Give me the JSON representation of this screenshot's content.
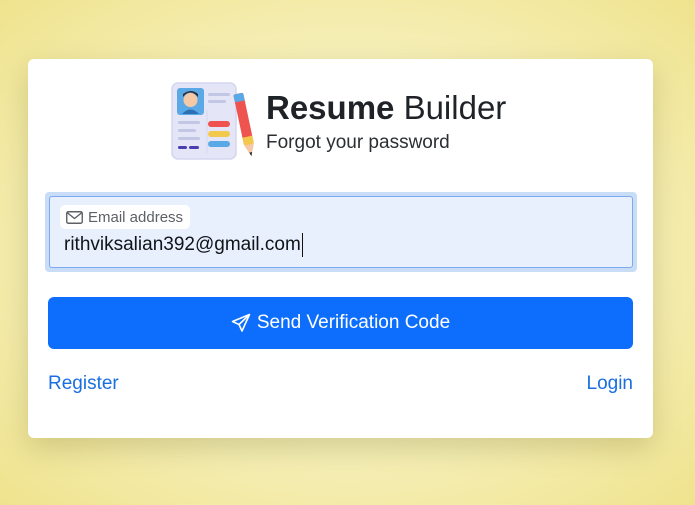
{
  "brand": {
    "title_bold": "Resume",
    "title_light": "Builder",
    "subtitle": "Forgot your password",
    "logo_icon": "resume-document-icon"
  },
  "form": {
    "email_label": "Email address",
    "email_label_icon": "envelope-icon",
    "email_value": "rithviksalian392@gmail.com",
    "email_focused": true
  },
  "actions": {
    "send_label": "Send Verification Code",
    "send_icon": "send-paper-plane-icon",
    "register_label": "Register",
    "login_label": "Login"
  },
  "colors": {
    "primary": "#0d6efd",
    "link": "#1a6fe0",
    "focus_ring": "#c9dcf8",
    "background": "#f6efb8"
  }
}
